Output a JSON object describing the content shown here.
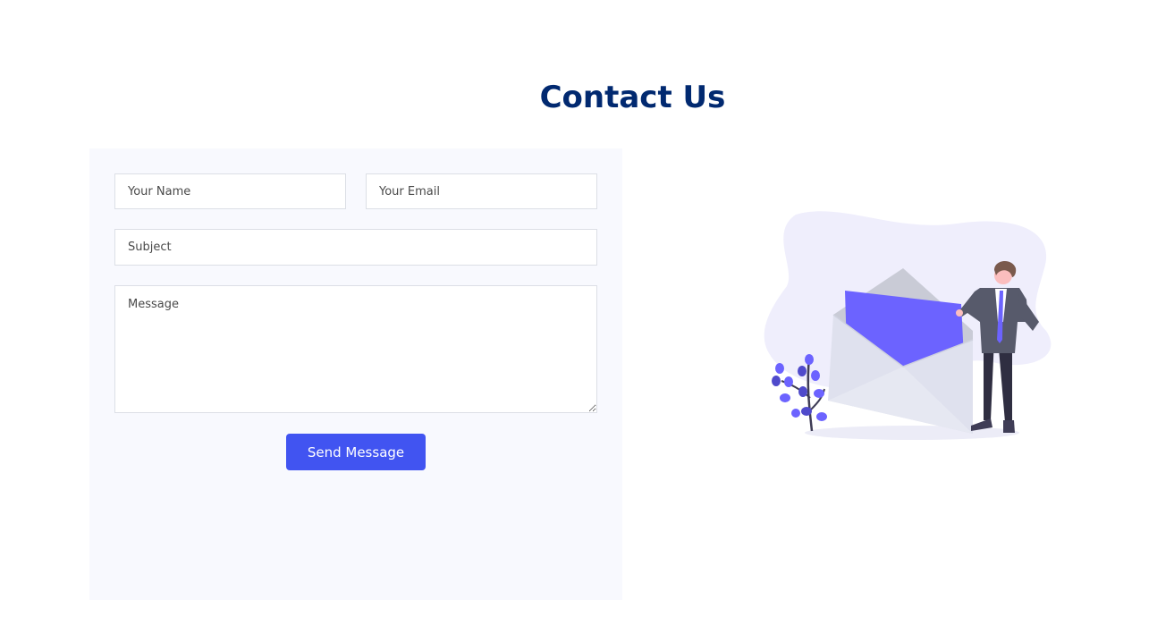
{
  "page": {
    "title": "Contact Us"
  },
  "form": {
    "name_placeholder": "Your Name",
    "name_value": "",
    "email_placeholder": "Your Email",
    "email_value": "",
    "subject_placeholder": "Subject",
    "subject_value": "",
    "message_placeholder": "Message",
    "message_value": "",
    "submit_label": "Send Message"
  },
  "illustration": {
    "icon": "mail-envelope-illustration",
    "colors": {
      "accent": "#6c63ff",
      "blob": "#efeefc",
      "envelope": "#dfe1ee"
    }
  },
  "colors": {
    "title": "#012970",
    "button": "#4154f1",
    "panel_bg": "#f8f9fe",
    "field_border": "#dcdfe6"
  }
}
